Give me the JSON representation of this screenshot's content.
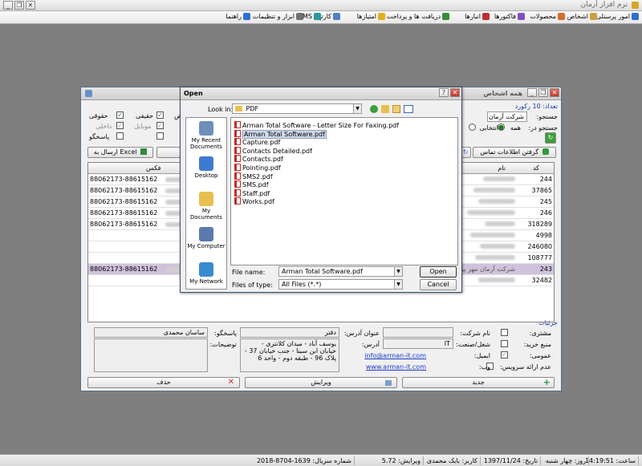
{
  "app": {
    "title": "نرم افزار آرمان"
  },
  "menu": [
    {
      "label": "امور پرسنلی",
      "icon": "people-icon",
      "color": "#2c6fd0"
    },
    {
      "label": "اشخاص",
      "icon": "person-icon",
      "color": "#c8a040"
    },
    {
      "label": "محصولات",
      "icon": "box-icon",
      "color": "#d07030"
    },
    {
      "label": "فاکتورها",
      "icon": "invoice-icon",
      "color": "#8050c0"
    },
    {
      "label": "انبارها",
      "icon": "warehouse-icon",
      "color": "#c03030"
    },
    {
      "label": "دریافت ها و پرداخت ها",
      "icon": "money-icon",
      "color": "#3a8a3a"
    },
    {
      "label": "امتیازها",
      "icon": "star-icon",
      "color": "#e0b020"
    },
    {
      "label": "کارتها",
      "icon": "card-icon",
      "color": "#5080c0"
    },
    {
      "label": "SMS",
      "icon": "sms-icon",
      "color": "#2a9a9a"
    },
    {
      "label": "ابزار و تنظیمات",
      "icon": "tools-icon",
      "color": "#707070"
    },
    {
      "label": "راهنما",
      "icon": "help-icon",
      "color": "#2c6fd0"
    }
  ],
  "main": {
    "title": "همه اشخاص",
    "count": "تعداد: 10 رکورد",
    "search_label": "جستجو:",
    "search_value": "شرکت آرمان",
    "search_in_label": "جستجو در:",
    "radio_all": "همه",
    "radio_selected": "انتخابی",
    "check_legal": "حقوقی",
    "check_real": "حقیقی",
    "check_internal": "داخلی",
    "check_mobile": "موبایل",
    "check_respondent": "پاسخگو",
    "check_partial": "ض",
    "btn_get_contacts": "گرفتن اطلاعات تماس",
    "btn_send_excel": "ارسال به Excel",
    "col_code": "کد",
    "col_name": "نام",
    "col_fax": "فکس",
    "rows": [
      {
        "code": "244",
        "fax": "88062173-88615162"
      },
      {
        "code": "37865",
        "fax": "88062173-88615162"
      },
      {
        "code": "245",
        "fax": "88062173-88615162"
      },
      {
        "code": "246",
        "fax": "88062173-88615162"
      },
      {
        "code": "318289",
        "fax": "88062173-88615162"
      },
      {
        "code": "4998",
        "fax": ""
      },
      {
        "code": "246080",
        "fax": ""
      },
      {
        "code": "108777",
        "fax": ""
      },
      {
        "code": "243",
        "fax": "88062173-88615162",
        "name": "شرکت آرمان مهر پرداز فردا"
      },
      {
        "code": "32482",
        "fax": ""
      }
    ]
  },
  "details": {
    "heading": "جزئیات",
    "customer_label": "مشتری:",
    "supplier_label": "منبع خرید:",
    "public_label": "عمومی:",
    "no_service_label": "عدم ارائه سرویس:",
    "company_label": "نام شرکت:",
    "job_label": "شغل/صنعت:",
    "email_label": "ایمیل:",
    "web_label": "وب:",
    "job_value": "IT",
    "email_value": "info@arman-it.com",
    "web_value": "www.arman-it.com",
    "address_title_label": "عنوان آدرس:",
    "address_title_value": "دفتر",
    "address_label": "آدرس:",
    "address_value": "یوسف آباد - میدان کلانتری - خیابان ابن سینا - جنب خیابان 37 - پلاک 96 - طبقه دوم - واحد 6",
    "respondent_label": "پاسخگو:",
    "respondent_value": "ساسان محمدی",
    "notes_label": "توضیحات:",
    "btn_new": "جدید",
    "btn_edit": "ویرایش",
    "btn_delete": "حذف"
  },
  "open_dialog": {
    "title": "Open",
    "look_in_label": "Look in:",
    "look_in_value": "PDF",
    "places": [
      "My Recent Documents",
      "Desktop",
      "My Documents",
      "My Computer",
      "My Network"
    ],
    "files": [
      "Arman Total Software - Letter Size For Faxing.pdf",
      "Arman Total Software.pdf",
      "Capture.pdf",
      "Contacts Detailed.pdf",
      "Contacts.pdf",
      "Pointing.pdf",
      "SMS2.pdf",
      "SMS.pdf",
      "Staff.pdf",
      "Works.pdf"
    ],
    "selected_index": 1,
    "file_name_label": "File name:",
    "file_name_value": "Arman Total Software.pdf",
    "file_type_label": "Files of type:",
    "file_type_value": "All Files (*.*)",
    "btn_open": "Open",
    "btn_cancel": "Cancel"
  },
  "status": {
    "serial": "شماره سریال: 1639-8704-2018",
    "version": "ویرایش: 5.72",
    "user": "کاربر: بابک محمدی",
    "date": "تاریخ: 1397/11/24",
    "day": "روز: چهار شنبه",
    "time": "ساعت: 14:19:51"
  }
}
